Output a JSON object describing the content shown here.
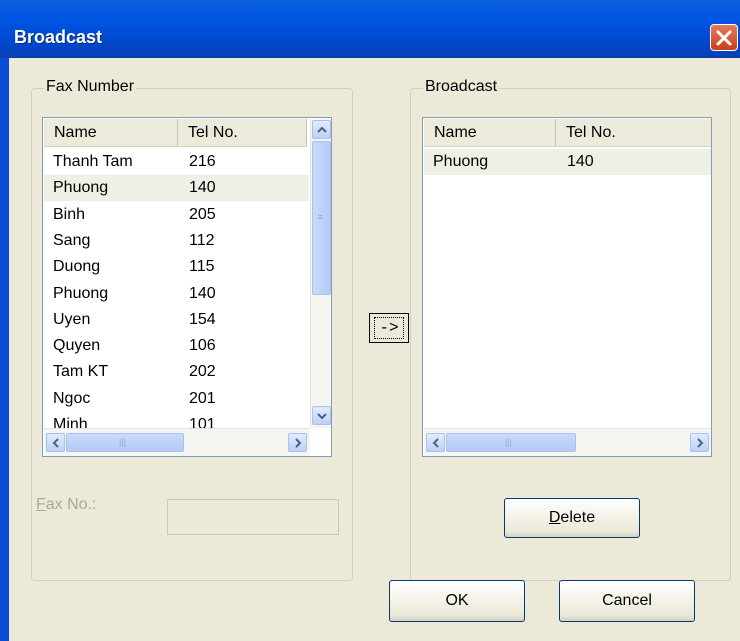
{
  "window": {
    "title": "Broadcast"
  },
  "fax_group": {
    "legend": "Fax Number",
    "columns": [
      "Name",
      "Tel No."
    ],
    "rows": [
      {
        "name": "Thanh Tam",
        "tel": "216"
      },
      {
        "name": "Phuong",
        "tel": "140"
      },
      {
        "name": "Binh",
        "tel": "205"
      },
      {
        "name": "Sang",
        "tel": "112"
      },
      {
        "name": "Duong",
        "tel": "115"
      },
      {
        "name": "Phuong",
        "tel": "140"
      },
      {
        "name": "Uyen",
        "tel": "154"
      },
      {
        "name": "Quyen",
        "tel": "106"
      },
      {
        "name": "Tam KT",
        "tel": "202"
      },
      {
        "name": "Ngoc",
        "tel": "201"
      },
      {
        "name": "Minh",
        "tel": "101"
      }
    ],
    "selected_row": 1,
    "fax_no_label_mnemonic": "F",
    "fax_no_label_rest": "ax No.:",
    "fax_no_value": ""
  },
  "move_button": {
    "label": "->"
  },
  "broadcast_group": {
    "legend": "Broadcast",
    "columns": [
      "Name",
      "Tel No."
    ],
    "rows": [
      {
        "name": "Phuong",
        "tel": "140"
      }
    ],
    "delete_mnemonic": "D",
    "delete_rest": "elete"
  },
  "buttons": {
    "ok": "OK",
    "cancel": "Cancel"
  },
  "colors": {
    "titlebar": "#0054e3",
    "dialog_bg": "#ece9d8",
    "selection": "#f0efe6"
  }
}
